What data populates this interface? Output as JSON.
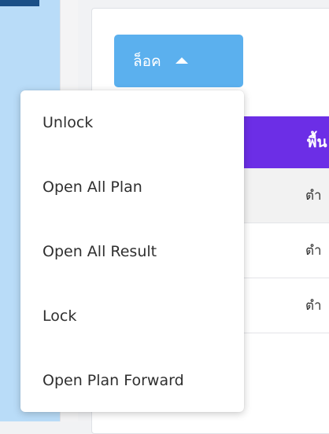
{
  "lock_button": {
    "label": "ล็อค",
    "caret_icon": "caret-up-icon"
  },
  "dropdown": {
    "items": [
      {
        "label": "Unlock"
      },
      {
        "label": "Open All Plan"
      },
      {
        "label": "Open All Result"
      },
      {
        "label": "Lock"
      },
      {
        "label": "Open Plan Forward"
      }
    ]
  },
  "table": {
    "header_label": "พื้น",
    "rows": [
      {
        "label": "ตำ"
      },
      {
        "label": "ตำ"
      },
      {
        "label": "ตำ"
      }
    ]
  },
  "colors": {
    "button": "#5bb0ee",
    "table_header": "#6c2ee6",
    "sidebar": "#b9dcf8"
  }
}
